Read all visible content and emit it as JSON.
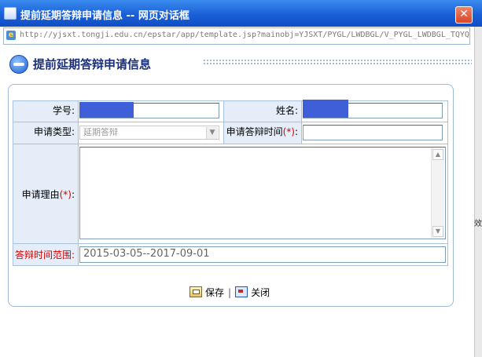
{
  "window": {
    "title": "提前延期答辩申请信息 -- 网页对话框",
    "url": "http://yjsxt.tongji.edu.cn/epstar/app/template.jsp?mainobj=YJSXT/PYGL/LWDBGL/V_PYGL_LWDBGL_TQYQ",
    "close_glyph": "✕",
    "side_char": "效"
  },
  "page": {
    "heading": "提前延期答辩申请信息"
  },
  "form": {
    "student_id_label": "学号:",
    "name_label": "姓名:",
    "apply_type_label": "申请类型:",
    "apply_type_value": "延期答辩",
    "apply_time_label": "申请答辩时间",
    "required_mark": "(*)",
    "apply_time_suffix": ":",
    "reason_label": "申请理由",
    "reason_suffix": ":",
    "range_label": "答辩时间范围:",
    "range_value": "2015-03-05--2017-09-01"
  },
  "actions": {
    "save_label": "保存",
    "separator": "|",
    "close_label": "关闭"
  },
  "colors": {
    "titlebar": "#1a5ed6",
    "label_bg": "#e5eef8",
    "required": "#d60000",
    "redaction": "#3e5fd8"
  }
}
